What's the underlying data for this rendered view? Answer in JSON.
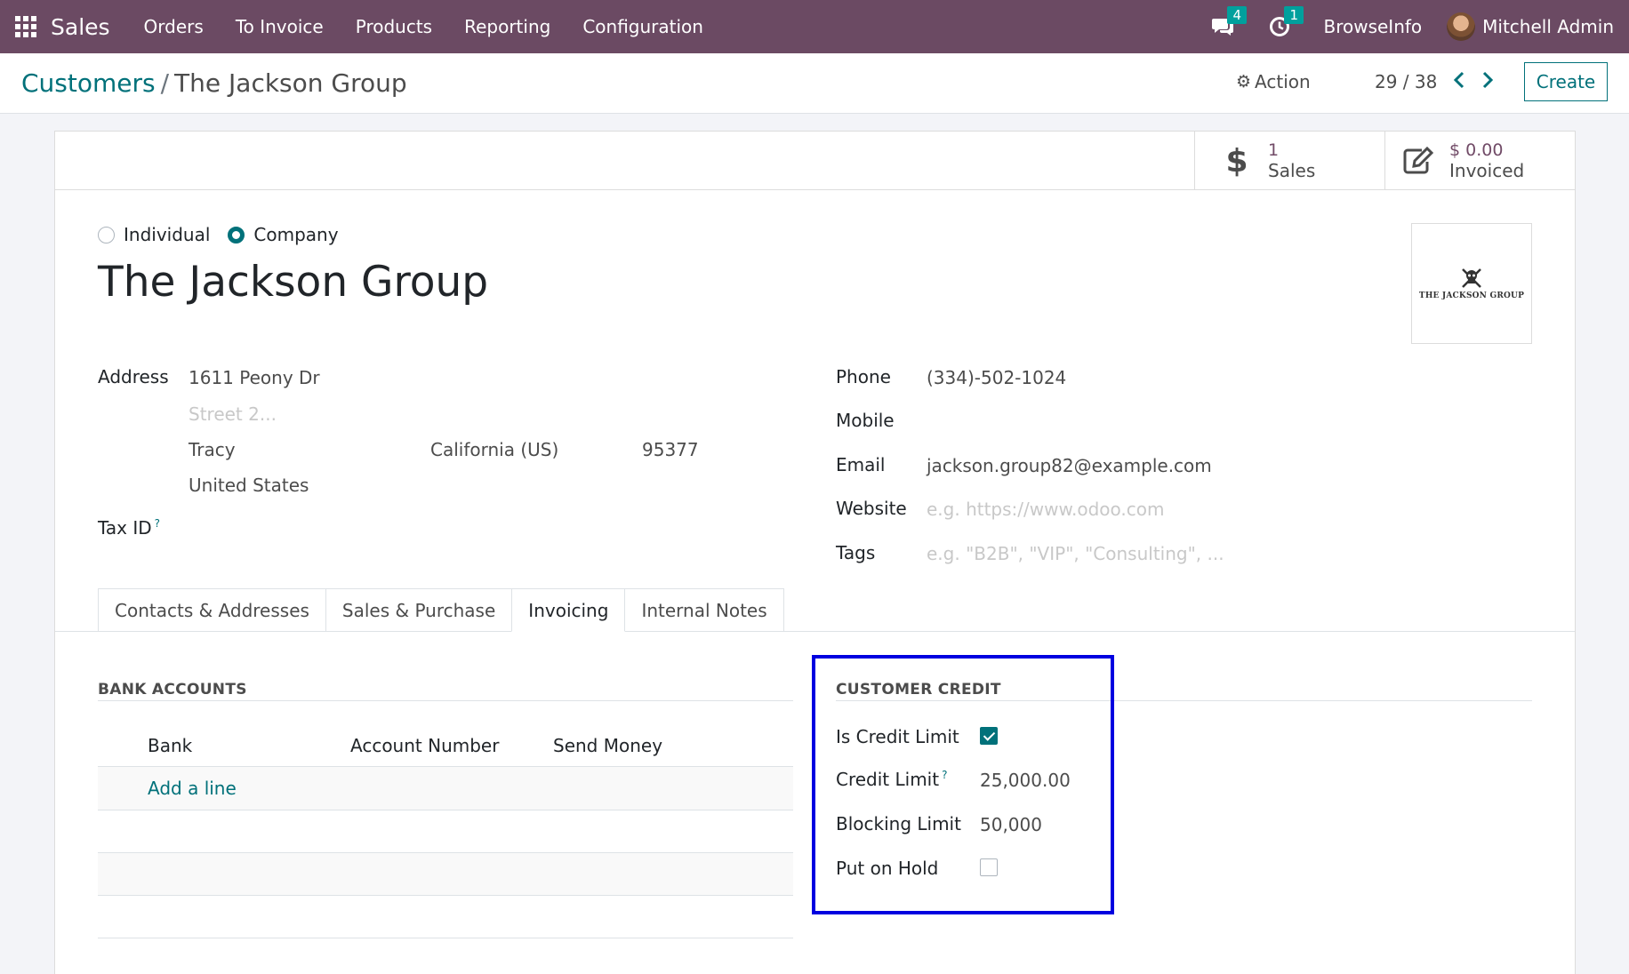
{
  "navbar": {
    "app_name": "Sales",
    "menu": [
      "Orders",
      "To Invoice",
      "Products",
      "Reporting",
      "Configuration"
    ],
    "messages_count": "4",
    "activities_count": "1",
    "company": "BrowseInfo",
    "user": "Mitchell Admin"
  },
  "control_panel": {
    "breadcrumb_parent": "Customers",
    "breadcrumb_separator": "/",
    "breadcrumb_current": "The Jackson Group",
    "action_label": "Action",
    "pager": "29 / 38",
    "create_label": "Create"
  },
  "smart_buttons": {
    "sales": {
      "value": "1",
      "label": "Sales"
    },
    "invoiced": {
      "value": "$ 0.00",
      "label": "Invoiced"
    }
  },
  "partner": {
    "type_options": [
      "Individual",
      "Company"
    ],
    "type_selected": "Company",
    "name": "The Jackson Group",
    "logo_text": "The Jackson Group",
    "address_label": "Address",
    "street": "1611 Peony Dr",
    "street2_placeholder": "Street 2...",
    "city": "Tracy",
    "state": "California (US)",
    "zip": "95377",
    "country": "United States",
    "tax_id_label": "Tax ID",
    "help_mark": "?",
    "phone_label": "Phone",
    "phone": "(334)-502-1024",
    "mobile_label": "Mobile",
    "mobile": "",
    "email_label": "Email",
    "email": "jackson.group82@example.com",
    "website_label": "Website",
    "website_placeholder": "e.g. https://www.odoo.com",
    "tags_label": "Tags",
    "tags_placeholder": "e.g. \"B2B\", \"VIP\", \"Consulting\", ..."
  },
  "tabs": [
    "Contacts & Addresses",
    "Sales & Purchase",
    "Invoicing",
    "Internal Notes"
  ],
  "active_tab": "Invoicing",
  "bank_accounts": {
    "title": "BANK ACCOUNTS",
    "columns": [
      "Bank",
      "Account Number",
      "Send Money"
    ],
    "add_line": "Add a line"
  },
  "customer_credit": {
    "title": "CUSTOMER CREDIT",
    "is_credit_limit_label": "Is Credit Limit",
    "is_credit_limit": true,
    "credit_limit_label": "Credit Limit",
    "credit_limit": "25,000.00",
    "blocking_limit_label": "Blocking Limit",
    "blocking_limit": "50,000",
    "put_on_hold_label": "Put on Hold",
    "put_on_hold": false
  },
  "colors": {
    "navbar": "#6b4a63",
    "accent": "#01717a",
    "highlight": "#0000e0"
  }
}
